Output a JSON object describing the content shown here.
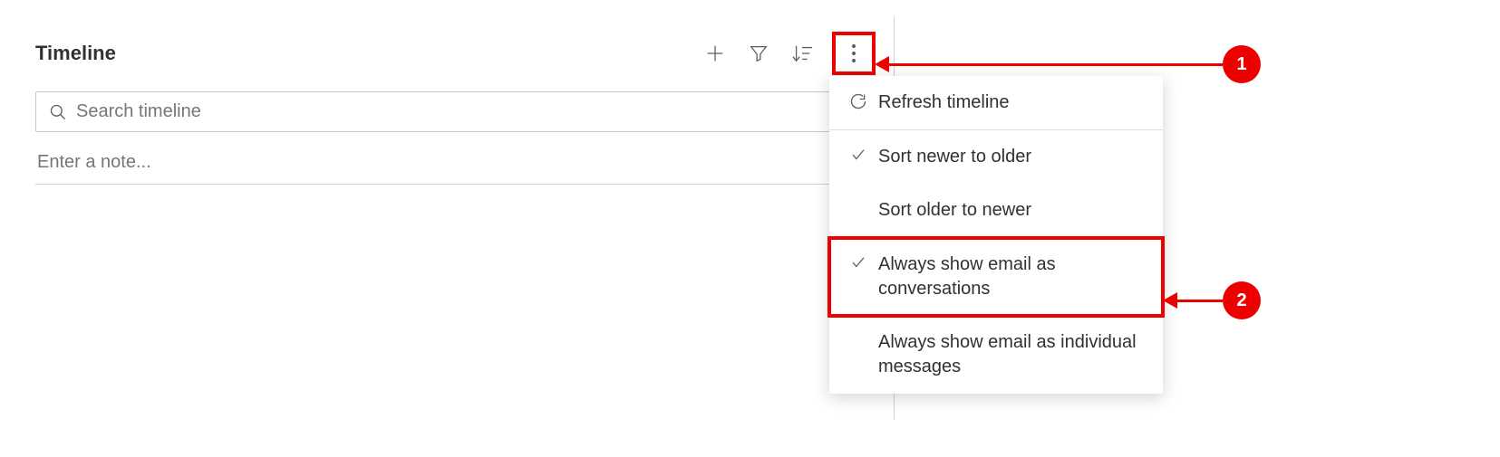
{
  "panel": {
    "title": "Timeline"
  },
  "search": {
    "placeholder": "Search timeline"
  },
  "note": {
    "placeholder": "Enter a note..."
  },
  "menu": {
    "refresh": "Refresh timeline",
    "sort_newer": "Sort newer to older",
    "sort_older": "Sort older to newer",
    "email_conversations": "Always show email as conversations",
    "email_individual": "Always show email as individual messages"
  },
  "callouts": {
    "one": "1",
    "two": "2"
  }
}
